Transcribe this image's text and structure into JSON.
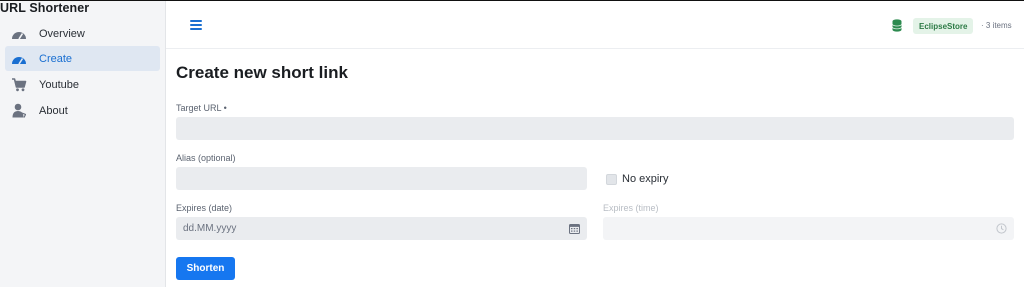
{
  "app": {
    "title": "URL Shortener"
  },
  "sidebar": {
    "items": [
      {
        "label": "Overview",
        "icon": "dashboard-icon",
        "active": false
      },
      {
        "label": "Create",
        "icon": "dashboard-icon",
        "active": true
      },
      {
        "label": "Youtube",
        "icon": "cart-icon",
        "active": false
      },
      {
        "label": "About",
        "icon": "user-icon",
        "active": false
      }
    ]
  },
  "header": {
    "store_badge": "EclipseStore",
    "items_count": "· 3 items"
  },
  "form": {
    "title": "Create new short link",
    "target_url": {
      "label": "Target URL •",
      "value": ""
    },
    "alias": {
      "label": "Alias (optional)",
      "value": ""
    },
    "no_expiry": {
      "label": "No expiry",
      "checked": false
    },
    "expires_date": {
      "label": "Expires (date)",
      "placeholder": "dd.MM.yyyy"
    },
    "expires_time": {
      "label": "Expires (time)",
      "value": ""
    },
    "submit_label": "Shorten"
  },
  "colors": {
    "accent": "#1677f0",
    "sidebar_bg": "#f4f5f7",
    "active_item_bg": "#dfe7f2",
    "badge_bg": "#e4f3e8",
    "badge_text": "#2c7a45",
    "input_bg": "#eaecef"
  }
}
